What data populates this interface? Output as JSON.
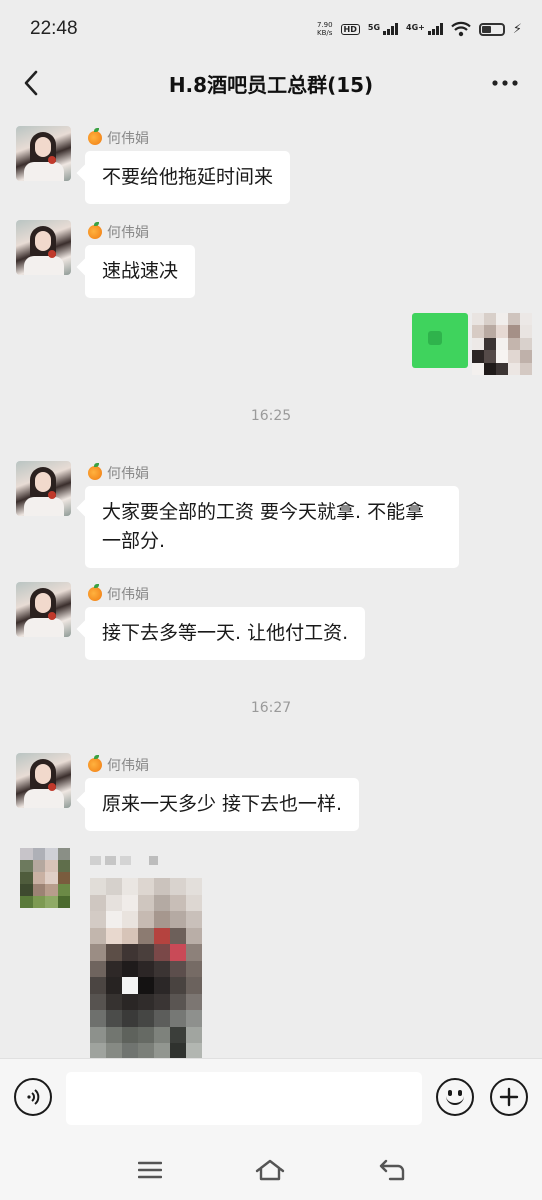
{
  "status_bar": {
    "time": "22:48",
    "net_speed_value": "7.90",
    "net_speed_unit": "KB/s",
    "hd_badge": "HD",
    "sim1_label": "5G",
    "sim2_label": "4G+",
    "icons": [
      "hd-icon",
      "signal-5g-icon",
      "signal-4g-icon",
      "wifi-icon",
      "battery-icon",
      "charging-icon"
    ]
  },
  "nav": {
    "title": "H.8酒吧员工总群(15)",
    "back_icon": "chevron-left-icon",
    "more_icon": "more-dots-icon"
  },
  "messages": [
    {
      "sender": "何伟娟",
      "text": "不要给他拖延时间来"
    },
    {
      "sender": "何伟娟",
      "text": "速战速决"
    },
    {
      "type": "image",
      "outgoing": true
    },
    {
      "type": "time",
      "text": "16:25"
    },
    {
      "sender": "何伟娟",
      "text": "大家要全部的工资 要今天就拿. 不能拿一部分."
    },
    {
      "sender": "何伟娟",
      "text": "接下去多等一天. 让他付工资."
    },
    {
      "type": "time",
      "text": "16:27"
    },
    {
      "sender": "何伟娟",
      "text": "原来一天多少 接下去也一样."
    },
    {
      "type": "image",
      "outgoing": false
    }
  ],
  "input_bar": {
    "voice_icon": "voice-icon",
    "input_value": "",
    "emoji_icon": "emoji-icon",
    "plus_icon": "plus-icon"
  },
  "system_nav": {
    "icons": [
      "menu-icon",
      "home-icon",
      "back-icon"
    ]
  }
}
